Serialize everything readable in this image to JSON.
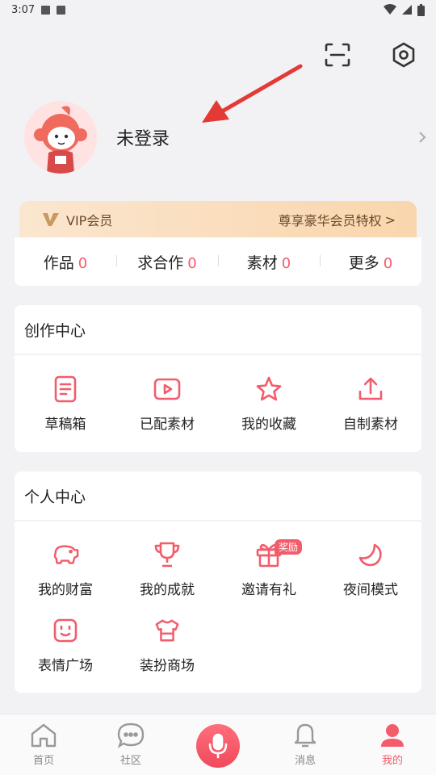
{
  "status_bar": {
    "time": "3:07"
  },
  "profile": {
    "login_text": "未登录"
  },
  "vip": {
    "label": "VIP会员",
    "promo": "尊享豪华会员特权",
    "promo_chevron": ">"
  },
  "stats": [
    {
      "label": "作品",
      "value": "0"
    },
    {
      "label": "求合作",
      "value": "0"
    },
    {
      "label": "素材",
      "value": "0"
    },
    {
      "label": "更多",
      "value": "0"
    }
  ],
  "creation_center": {
    "title": "创作中心",
    "items": [
      {
        "label": "草稿箱",
        "icon": "draft-document-icon"
      },
      {
        "label": "已配素材",
        "icon": "video-play-icon"
      },
      {
        "label": "我的收藏",
        "icon": "star-icon"
      },
      {
        "label": "自制素材",
        "icon": "upload-icon"
      }
    ]
  },
  "personal_center": {
    "title": "个人中心",
    "items": [
      {
        "label": "我的财富",
        "icon": "piggy-bank-icon"
      },
      {
        "label": "我的成就",
        "icon": "trophy-icon"
      },
      {
        "label": "邀请有礼",
        "icon": "gift-icon",
        "badge": "奖励"
      },
      {
        "label": "夜间模式",
        "icon": "moon-icon"
      },
      {
        "label": "表情广场",
        "icon": "emoji-face-icon"
      },
      {
        "label": "装扮商场",
        "icon": "shirt-icon"
      }
    ]
  },
  "tab_bar": {
    "items": [
      {
        "label": "首页",
        "icon": "home-icon"
      },
      {
        "label": "社区",
        "icon": "chat-bubble-icon"
      },
      {
        "label": "",
        "icon": "microphone-icon"
      },
      {
        "label": "消息",
        "icon": "bell-icon"
      },
      {
        "label": "我的",
        "icon": "person-icon",
        "active": true
      }
    ]
  },
  "colors": {
    "accent": "#f25c6b",
    "vip_text": "#6b4a2b",
    "background": "#f2f2f4"
  }
}
